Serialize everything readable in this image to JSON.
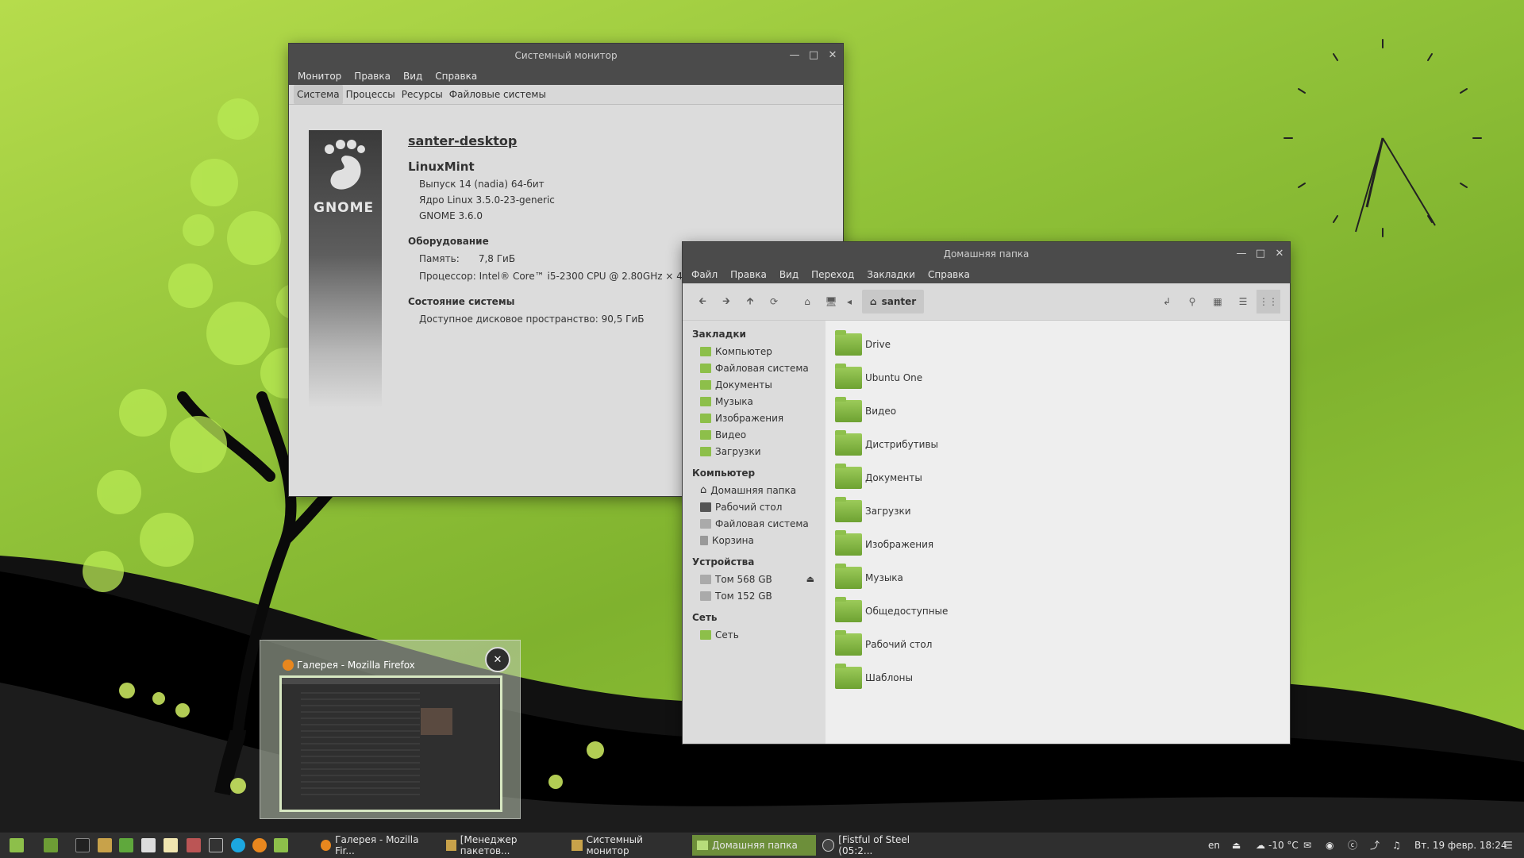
{
  "desktop": {
    "accent": "#7fb22e"
  },
  "system_monitor": {
    "title": "Системный монитор",
    "menu": [
      "Монитор",
      "Правка",
      "Вид",
      "Справка"
    ],
    "tabs": [
      "Система",
      "Процессы",
      "Ресурсы",
      "Файловые системы"
    ],
    "active_tab": "Система",
    "logo_text": "GNOME",
    "hostname": "santer-desktop",
    "distro": "LinuxMint",
    "release": "Выпуск 14 (nadia) 64-бит",
    "kernel": "Ядро Linux 3.5.0-23-generic",
    "gnome": "GNOME 3.6.0",
    "hardware_title": "Оборудование",
    "memory_label": "Память:",
    "memory_value": "7,8 ГиБ",
    "cpu_label": "Процессор:",
    "cpu_value": "Intel® Core™ i5-2300 CPU @ 2.80GHz × 4",
    "status_title": "Состояние системы",
    "disk_label": "Доступное дисковое пространство:",
    "disk_value": "90,5 ГиБ"
  },
  "file_manager": {
    "title": "Домашняя папка",
    "menu": [
      "Файл",
      "Правка",
      "Вид",
      "Переход",
      "Закладки",
      "Справка"
    ],
    "path_crumb": "santer",
    "sidebar": {
      "bookmarks_title": "Закладки",
      "bookmarks": [
        "Компьютер",
        "Файловая система",
        "Документы",
        "Музыка",
        "Изображения",
        "Видео",
        "Загрузки"
      ],
      "computer_title": "Компьютер",
      "computer": [
        "Домашняя папка",
        "Рабочий стол",
        "Файловая система",
        "Корзина"
      ],
      "devices_title": "Устройства",
      "devices": [
        "Том 568 GB",
        "Том 152 GB"
      ],
      "network_title": "Сеть",
      "network": [
        "Сеть"
      ]
    },
    "files": [
      "Drive",
      "Ubuntu One",
      "Видео",
      "Дистрибутивы",
      "Документы",
      "Загрузки",
      "Изображения",
      "Музыка",
      "Общедоступные",
      "Рабочий стол",
      "Шаблоны"
    ]
  },
  "preview": {
    "title": "Галерея - Mozilla Firefox"
  },
  "taskbar": {
    "windows": [
      "Галерея - Mozilla Fir...",
      "[Менеджер пакетов...",
      "Системный монитор",
      "Домашняя папка",
      "[Fistful of Steel (05:2..."
    ],
    "active_window": "Домашняя папка",
    "keyboard_layout": "en",
    "weather": "-10 °C",
    "datetime": "Вт. 19 февр. 18:24"
  }
}
